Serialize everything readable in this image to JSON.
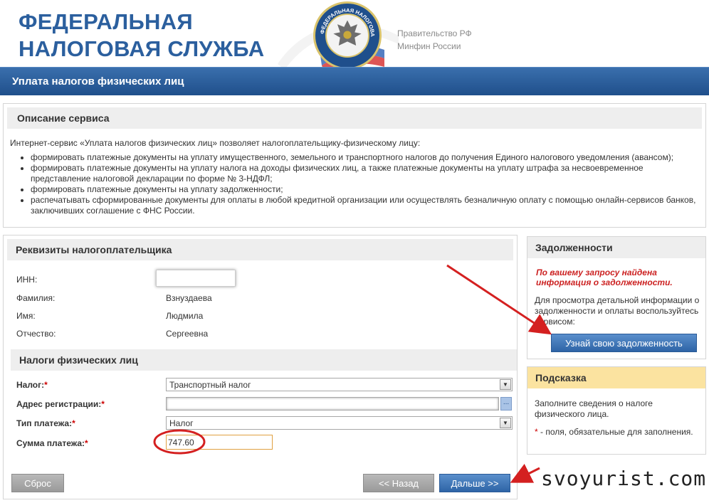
{
  "header": {
    "brand_line1": "ФЕДЕРАЛЬНАЯ",
    "brand_line2": "НАЛОГОВАЯ СЛУЖБА",
    "gov_line1": "Правительство РФ",
    "gov_line2": "Минфин России",
    "emblem_text": "ФЕДЕРАЛЬНАЯ НАЛОГОВАЯ СЛУЖБА"
  },
  "titlebar": {
    "title": "Уплата налогов физических лиц"
  },
  "description": {
    "heading": "Описание сервиса",
    "intro": "Интернет-сервис «Уплата налогов физических лиц» позволяет налогоплательщику-физическому лицу:",
    "items": [
      "формировать платежные документы на уплату имущественного, земельного и транспортного налогов до получения Единого налогового уведомления (авансом);",
      "формировать платежные документы на уплату налога на доходы физических лиц, а также платежные документы на уплату штрафа за несвоевременное представление налоговой декларации по форме № 3-НДФЛ;",
      "формировать платежные документы на уплату задолженности;",
      "распечатывать сформированные документы для оплаты в любой кредитной организации или осуществлять безналичную оплату с помощью онлайн-сервисов банков, заключивших соглашение с ФНС России."
    ]
  },
  "taxpayer": {
    "heading": "Реквизиты налогоплательщика",
    "inn_label": "ИНН:",
    "inn_value": "",
    "surname_label": "Фамилия:",
    "surname_value": "Взнуздаева",
    "name_label": "Имя:",
    "name_value": "Людмила",
    "patronymic_label": "Отчество:",
    "patronymic_value": "Сергеевна"
  },
  "taxes": {
    "heading": "Налоги физических лиц",
    "tax_label": "Налог:",
    "tax_value": "Транспортный налог",
    "address_label": "Адрес регистрации:",
    "address_value": "",
    "address_button": "...",
    "payment_type_label": "Тип платежа:",
    "payment_type_value": "Налог",
    "amount_label": "Сумма платежа:",
    "amount_value": "747.60",
    "required_mark": "*"
  },
  "buttons": {
    "reset": "Сброс",
    "back": "<< Назад",
    "next": "Дальше >>"
  },
  "debts": {
    "heading": "Задолженности",
    "found": "По вашему запросу найдена информация о задолженности.",
    "text": "Для просмотра детальной информации о задолженности и оплаты воспользуйтесь сервисом:",
    "button": "Узнай свою задолженность"
  },
  "hint": {
    "heading": "Подсказка",
    "text": "Заполните сведения о налоге физического лица.",
    "note_star": "*",
    "note": " - поля, обязательные для заполнения."
  },
  "watermark": "svoyurist.com",
  "colors": {
    "brand_blue": "#2b5f9e",
    "titlebar": "#1f4f8b",
    "required_red": "#cc0000",
    "annotation_red": "#d42020",
    "hint_yellow": "#fbe3a0"
  }
}
